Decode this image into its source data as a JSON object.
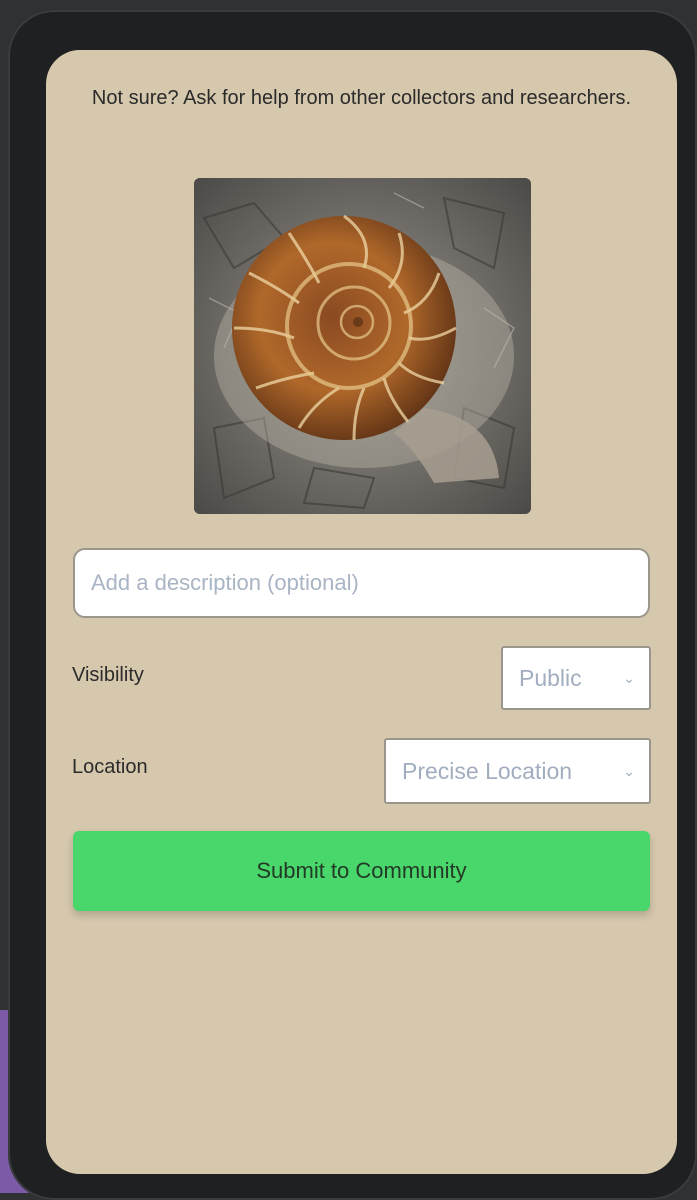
{
  "screen": {
    "help_text": "Not sure? Ask for help from other collectors and researchers.",
    "photo_label": "ammonite-fossil-photo"
  },
  "description": {
    "placeholder": "Add a description (optional)",
    "value": ""
  },
  "visibility": {
    "label": "Visibility",
    "selected": "Public"
  },
  "location": {
    "label": "Location",
    "selected": "Precise Location"
  },
  "submit": {
    "label": "Submit to Community"
  },
  "colors": {
    "screen_bg": "#d6c8ad",
    "submit_bg": "#49d66a",
    "placeholder": "#a9b4c4"
  }
}
